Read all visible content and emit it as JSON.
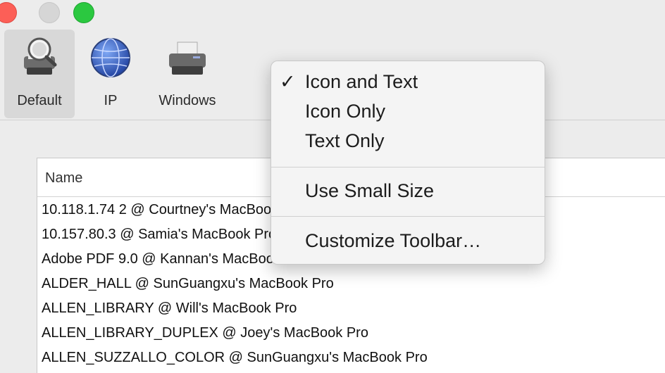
{
  "toolbar": {
    "items": [
      {
        "label": "Default",
        "icon": "printer-search-icon",
        "selected": true
      },
      {
        "label": "IP",
        "icon": "globe-network-icon",
        "selected": false
      },
      {
        "label": "Windows",
        "icon": "printer-icon",
        "selected": false
      }
    ]
  },
  "table": {
    "header": "Name",
    "rows": [
      "10.118.1.74 2 @ Courtney's MacBook Pro",
      "10.157.80.3 @ Samia's MacBook Pro",
      "Adobe PDF 9.0 @ Kannan's MacBook Air",
      "ALDER_HALL @ SunGuangxu's MacBook Pro",
      "ALLEN_LIBRARY @ Will's MacBook Pro",
      "ALLEN_LIBRARY_DUPLEX @ Joey's MacBook Pro",
      "ALLEN_SUZZALLO_COLOR @ SunGuangxu's MacBook Pro"
    ]
  },
  "menu": {
    "items": [
      {
        "label": "Icon and Text",
        "checked": "✓"
      },
      {
        "label": "Icon Only",
        "checked": ""
      },
      {
        "label": "Text Only",
        "checked": ""
      },
      {
        "label": "Use Small Size",
        "checked": ""
      },
      {
        "label": "Customize Toolbar…",
        "checked": ""
      }
    ]
  },
  "colors": {
    "close": "#fc5f57",
    "minimize": "#d6d6d6",
    "maximize": "#2bc840"
  }
}
